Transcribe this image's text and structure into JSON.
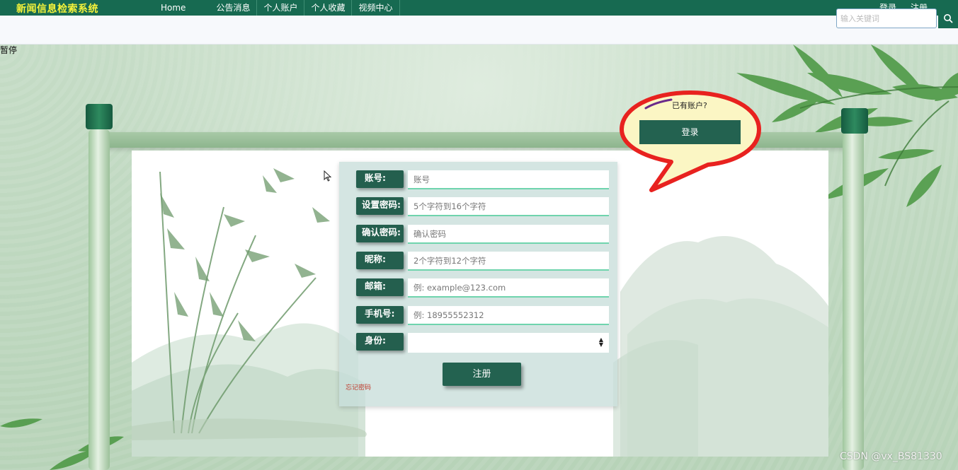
{
  "navbar": {
    "brand": "新闻信息检索系统",
    "items": [
      {
        "label": "Home"
      },
      {
        "label": "公告消息"
      },
      {
        "label": "个人账户"
      },
      {
        "label": "个人收藏"
      },
      {
        "label": "视频中心"
      }
    ],
    "login": "登录",
    "register": "注册"
  },
  "search": {
    "placeholder": "输入关键词",
    "icon": "search-icon"
  },
  "overlay_text": "暂停",
  "form": {
    "fields": [
      {
        "label": "账号:",
        "placeholder": "账号"
      },
      {
        "label": "设置密码:",
        "placeholder": "5个字符到16个字符"
      },
      {
        "label": "确认密码:",
        "placeholder": "确认密码"
      },
      {
        "label": "昵称:",
        "placeholder": "2个字符到12个字符"
      },
      {
        "label": "邮箱:",
        "placeholder": "例: example@123.com"
      },
      {
        "label": "手机号:",
        "placeholder": "例: 18955552312"
      }
    ],
    "identity_label": "身份:",
    "identity_value": "",
    "submit": "注册",
    "forgot": "忘记密码"
  },
  "callout": {
    "question": "已有账户?",
    "login_button": "登录",
    "outline_color": "#e8221f",
    "fill_color": "#fbf6c4"
  },
  "watermark": "CSDN @vx_BS81330",
  "colors": {
    "nav_bg": "#176a51",
    "brand": "#f6f33a",
    "button": "#236250",
    "input_underline": "#6fd4ad"
  }
}
